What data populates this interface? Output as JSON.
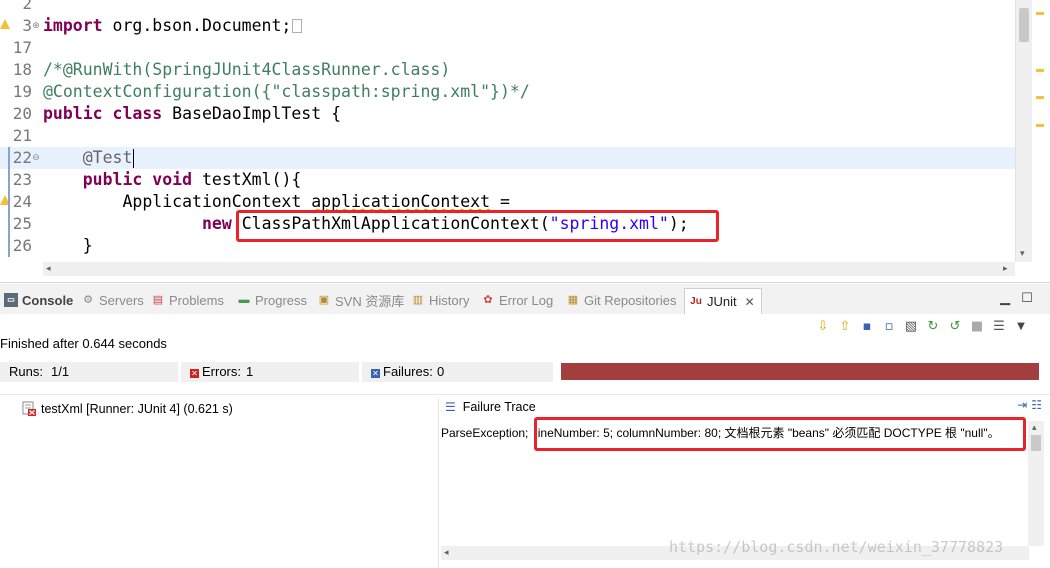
{
  "editor": {
    "lines": [
      {
        "num": "2"
      },
      {
        "num": "3",
        "text": "import org.bson.Document;"
      },
      {
        "num": "17"
      },
      {
        "num": "18",
        "text": "/*@RunWith(SpringJUnit4ClassRunner.class)"
      },
      {
        "num": "19",
        "text": "@ContextConfiguration({\"classpath:spring.xml\"})*/"
      },
      {
        "num": "20",
        "kw1": "public",
        "kw2": "class",
        "text": "BaseDaoImplTest {"
      },
      {
        "num": "21"
      },
      {
        "num": "22",
        "text": "@Test"
      },
      {
        "num": "23",
        "kw1": "public",
        "kw2": "void",
        "text": "testXml(){"
      },
      {
        "num": "24",
        "text": "ApplicationContext",
        "squig": "applicationContext",
        "rest": " ="
      },
      {
        "num": "25",
        "kw1": "new",
        "text": "ClassPathXmlApplicationContext(",
        "str": "\"spring.xml\"",
        "rest": ");"
      },
      {
        "num": "26",
        "text": "}"
      }
    ]
  },
  "views": {
    "tabs": [
      "Console",
      "Servers",
      "Problems",
      "Progress",
      "SVN 资源库",
      "History",
      "Error Log",
      "Git Repositories",
      "JUnit"
    ],
    "active": "JUnit"
  },
  "junit": {
    "finished": "Finished after 0.644 seconds",
    "runs_label": "Runs:",
    "runs_value": "1/1",
    "errors_label": "Errors:",
    "errors_value": "1",
    "failures_label": "Failures:",
    "failures_value": "0",
    "progress_color": "#a33e3e",
    "test_item": "testXml [Runner: JUnit 4] (0.621 s)",
    "trace_title": "Failure Trace",
    "trace_prefix": "ParseException;",
    "trace_highlight": "ineNumber: 5; columnNumber: 80; 文档根元素 \"beans\" 必须匹配 DOCTYPE 根 \"null\"。"
  },
  "watermark": "https://blog.csdn.net/weixin_37778823"
}
